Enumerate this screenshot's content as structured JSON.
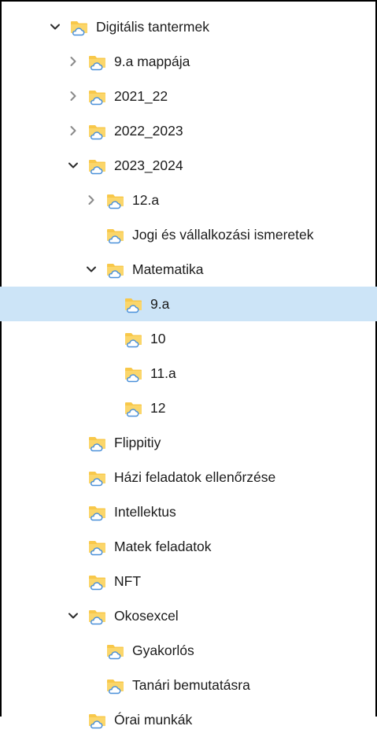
{
  "tree": {
    "items": [
      {
        "label": "Digitális tantermek",
        "level": 0,
        "state": "expanded",
        "selected": false
      },
      {
        "label": "9.a mappája",
        "level": 1,
        "state": "collapsed",
        "selected": false
      },
      {
        "label": "2021_22",
        "level": 1,
        "state": "collapsed",
        "selected": false
      },
      {
        "label": "2022_2023",
        "level": 1,
        "state": "collapsed",
        "selected": false
      },
      {
        "label": "2023_2024",
        "level": 1,
        "state": "expanded",
        "selected": false
      },
      {
        "label": "12.a",
        "level": 2,
        "state": "collapsed",
        "selected": false
      },
      {
        "label": "Jogi és vállalkozási ismeretek",
        "level": 2,
        "state": "none",
        "selected": false
      },
      {
        "label": "Matematika",
        "level": 2,
        "state": "expanded",
        "selected": false
      },
      {
        "label": "9.a",
        "level": 3,
        "state": "none",
        "selected": true
      },
      {
        "label": "10",
        "level": 3,
        "state": "none",
        "selected": false
      },
      {
        "label": "11.a",
        "level": 3,
        "state": "none",
        "selected": false
      },
      {
        "label": "12",
        "level": 3,
        "state": "none",
        "selected": false
      },
      {
        "label": "Flippitiy",
        "level": 1,
        "state": "none",
        "selected": false
      },
      {
        "label": "Házi feladatok ellenőrzése",
        "level": 1,
        "state": "none",
        "selected": false
      },
      {
        "label": "Intellektus",
        "level": 1,
        "state": "none",
        "selected": false
      },
      {
        "label": "Matek feladatok",
        "level": 1,
        "state": "none",
        "selected": false
      },
      {
        "label": "NFT",
        "level": 1,
        "state": "none",
        "selected": false
      },
      {
        "label": "Okosexcel",
        "level": 1,
        "state": "expanded",
        "selected": false
      },
      {
        "label": "Gyakorlós",
        "level": 2,
        "state": "none",
        "selected": false
      },
      {
        "label": "Tanári bemutatásra",
        "level": 2,
        "state": "none",
        "selected": false
      },
      {
        "label": "Órai munkák",
        "level": 1,
        "state": "none",
        "selected": false
      }
    ]
  },
  "icons": {
    "expanded": "chevron-down-icon",
    "collapsed": "chevron-right-icon",
    "folder": "cloud-folder-icon"
  },
  "colors": {
    "selected_bg": "#cce4f7",
    "folder_yellow": "#f8c84a",
    "cloud_blue": "#4a90d9"
  }
}
